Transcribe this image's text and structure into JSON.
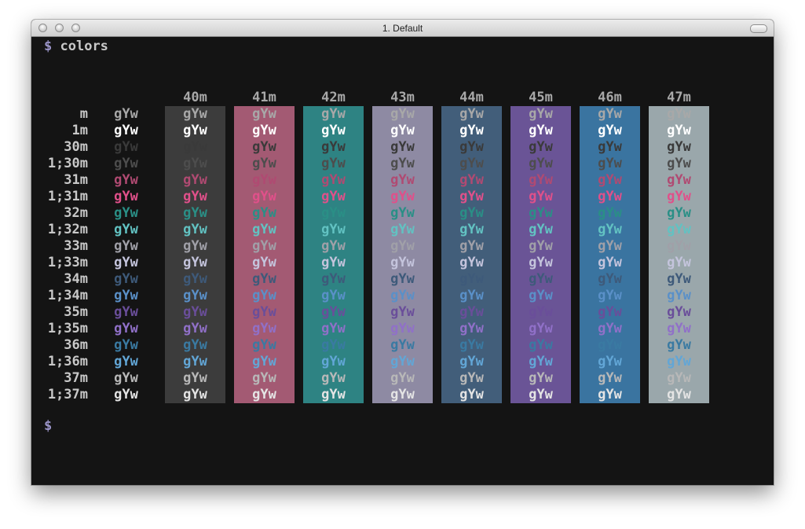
{
  "window": {
    "title": "1. Default"
  },
  "terminal": {
    "prompt_symbol": "$",
    "command": "colors",
    "sample_text": "gYw"
  },
  "bg_columns": [
    {
      "label": "40m",
      "color": "#3c3c3c"
    },
    {
      "label": "41m",
      "color": "#a35a73"
    },
    {
      "label": "42m",
      "color": "#2e8383"
    },
    {
      "label": "43m",
      "color": "#8e8aa3"
    },
    {
      "label": "44m",
      "color": "#425e7a"
    },
    {
      "label": "45m",
      "color": "#6a5496"
    },
    {
      "label": "46m",
      "color": "#3a74a0"
    },
    {
      "label": "47m",
      "color": "#9aa7ab"
    }
  ],
  "rows": [
    {
      "label": "m",
      "color": "#a8a8a8"
    },
    {
      "label": "1m",
      "color": "#ffffff"
    },
    {
      "label": "30m",
      "color": "#3a3a3a"
    },
    {
      "label": "1;30m",
      "color": "#4d4d4d"
    },
    {
      "label": "31m",
      "color": "#b04a72"
    },
    {
      "label": "1;31m",
      "color": "#e0508a"
    },
    {
      "label": "32m",
      "color": "#2a8f86"
    },
    {
      "label": "1;32m",
      "color": "#62c2c2"
    },
    {
      "label": "33m",
      "color": "#a0a0a8"
    },
    {
      "label": "1;33m",
      "color": "#c4c4dc"
    },
    {
      "label": "34m",
      "color": "#3e5a7a"
    },
    {
      "label": "1;34m",
      "color": "#5a90c8"
    },
    {
      "label": "35m",
      "color": "#6a4e9a"
    },
    {
      "label": "1;35m",
      "color": "#9070c8"
    },
    {
      "label": "36m",
      "color": "#3a7aa2"
    },
    {
      "label": "1;36m",
      "color": "#62a6d6"
    },
    {
      "label": "37m",
      "color": "#b8b8b8"
    },
    {
      "label": "1;37m",
      "color": "#e4e4e4"
    }
  ]
}
